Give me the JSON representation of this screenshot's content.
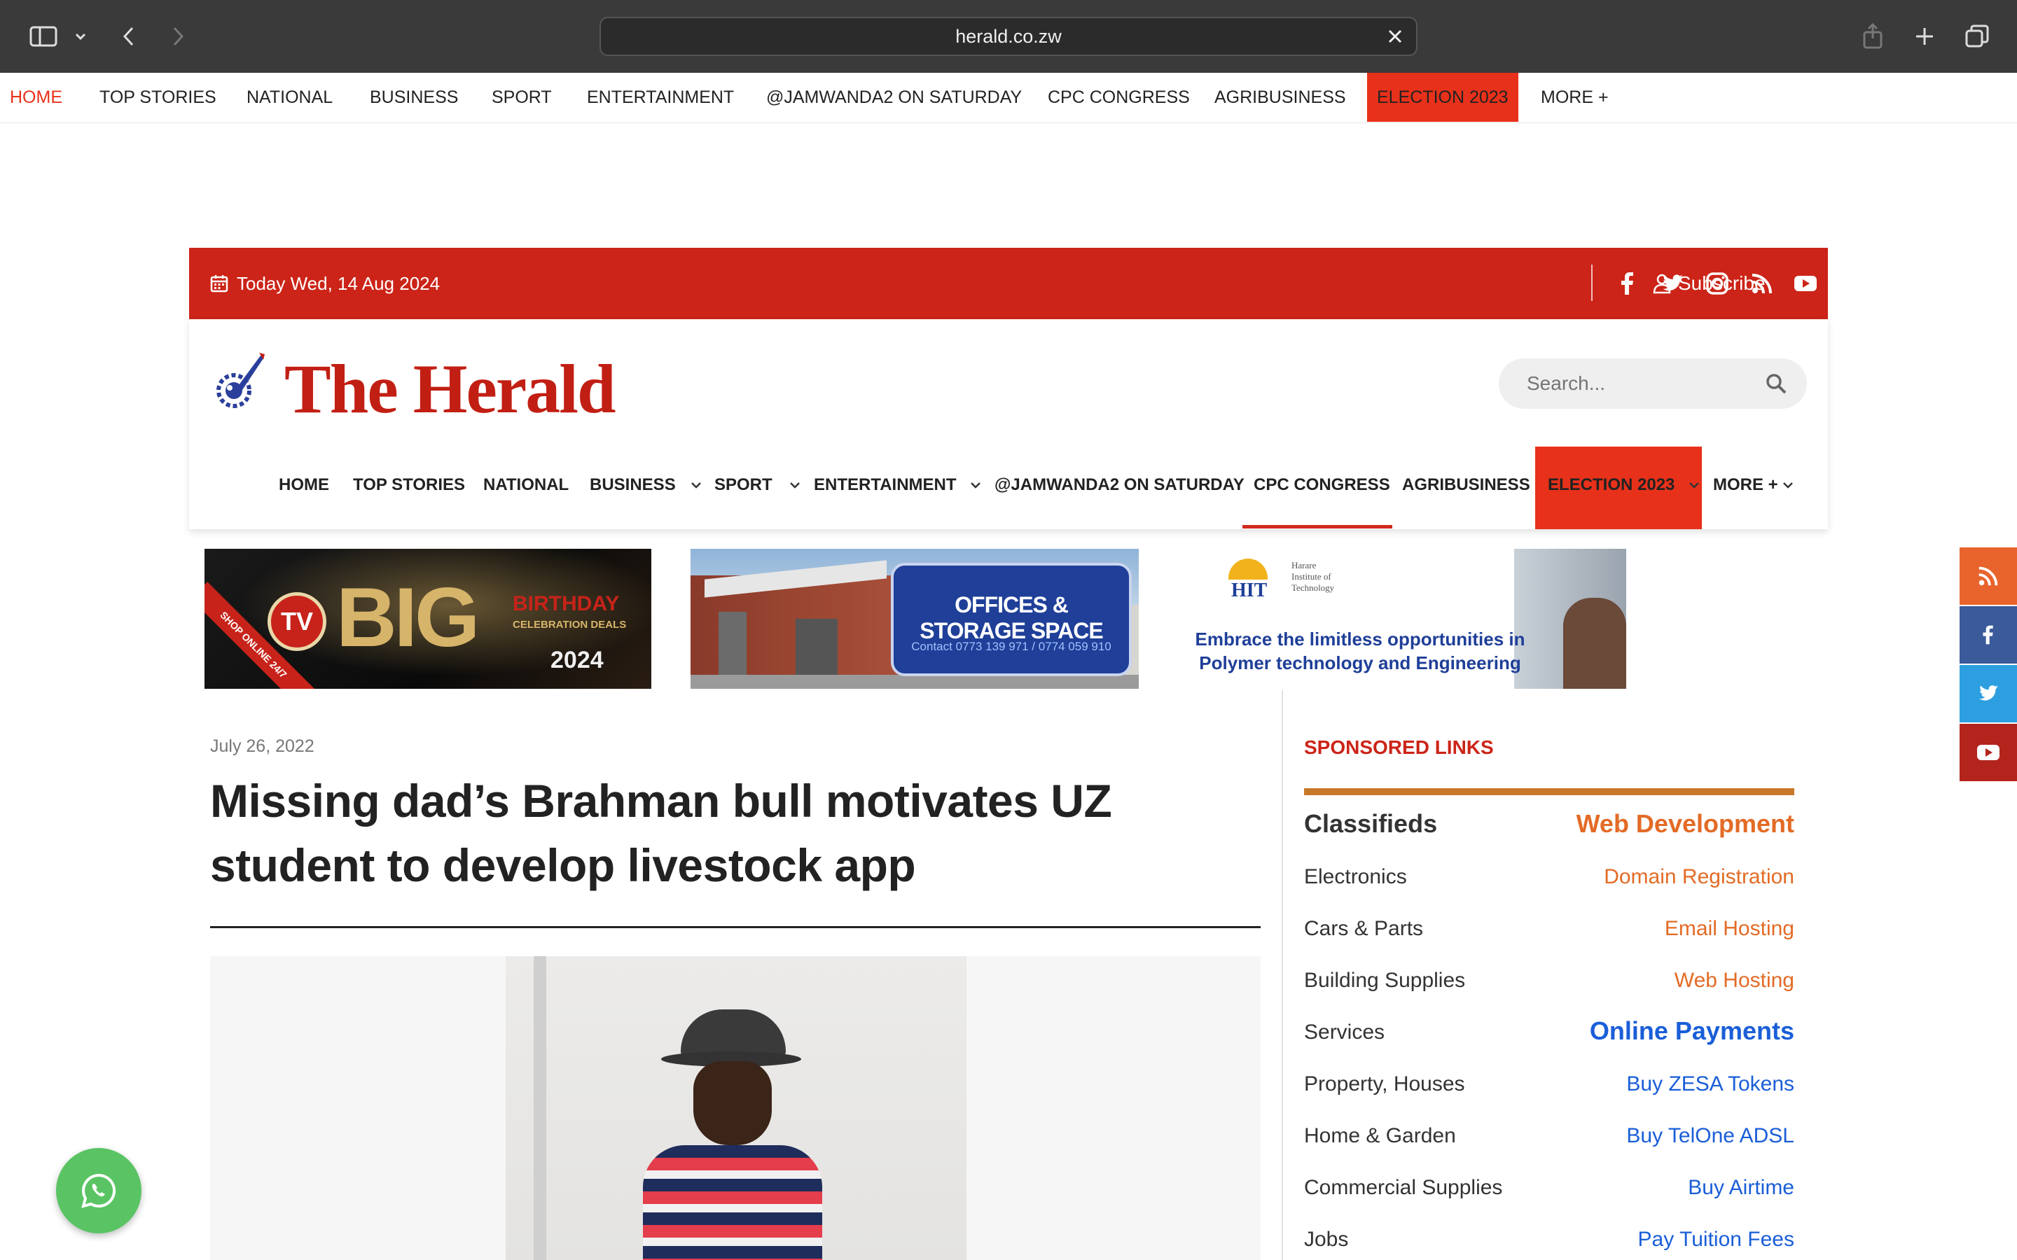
{
  "browser": {
    "url": "herald.co.zw"
  },
  "top_nav": {
    "items": [
      "HOME",
      "TOP STORIES",
      "NATIONAL",
      "BUSINESS",
      "SPORT",
      "ENTERTAINMENT",
      "@JAMWANDA2 ON SATURDAY",
      "CPC CONGRESS",
      "AGRIBUSINESS",
      "ELECTION 2023",
      "MORE +"
    ],
    "active": "HOME",
    "highlight": "ELECTION 2023"
  },
  "date_bar": {
    "date_text": "Today Wed, 14 Aug 2024",
    "subscribe_label": "Subscribe",
    "social": [
      "facebook-icon",
      "twitter-icon",
      "instagram-icon",
      "rss-icon",
      "youtube-icon"
    ],
    "color": "#cc2418"
  },
  "header": {
    "logo_text": "The Herald",
    "search_placeholder": "Search..."
  },
  "main_nav": {
    "items": [
      "HOME",
      "TOP STORIES",
      "NATIONAL",
      "BUSINESS",
      "SPORT",
      "ENTERTAINMENT",
      "@JAMWANDA2 ON SATURDAY",
      "CPC CONGRESS",
      "AGRIBUSINESS",
      "ELECTION 2023",
      "MORE +"
    ]
  },
  "ads": {
    "ad1": {
      "tv": "TV",
      "big": "BIG",
      "line1": "BIRTHDAY",
      "line2": "CELEBRATION DEALS",
      "year": "2024",
      "ribbon": "SHOP ONLINE 24/7"
    },
    "ad2": {
      "title": "OFFICES & STORAGE SPACE",
      "contact": "Contact 0773 139 971 / 0774 059 910"
    },
    "ad3": {
      "logo": "HIT",
      "org_line1": "Harare",
      "org_line2": "Institute of",
      "org_line3": "Technology",
      "text": "Embrace the limitless opportunities in Polymer technology and Engineering"
    }
  },
  "article": {
    "date": "July 26, 2022",
    "title": "Missing dad’s Brahman bull motivates UZ student to develop livestock app"
  },
  "sidebar": {
    "title": "SPONSORED LINKS",
    "classifieds_heading": "Classifieds",
    "classifieds": [
      "Electronics",
      "Cars & Parts",
      "Building Supplies",
      "Services",
      "Property, Houses",
      "Home & Garden",
      "Commercial Supplies",
      "Jobs"
    ],
    "webdev_heading": "Web Development",
    "webdev": [
      "Domain Registration",
      "Email Hosting",
      "Web Hosting"
    ],
    "payments_heading": "Online Payments",
    "payments": [
      "Buy ZESA Tokens",
      "Buy TelOne ADSL",
      "Buy Airtime",
      "Pay Tuition Fees"
    ]
  },
  "floating_social": [
    "rss-icon",
    "facebook-icon",
    "twitter-icon",
    "youtube-icon"
  ],
  "colors": {
    "brand_red": "#cc2418",
    "accent_orange": "#e36b26",
    "link_blue": "#1a5ed8",
    "whatsapp": "#5ac464"
  }
}
